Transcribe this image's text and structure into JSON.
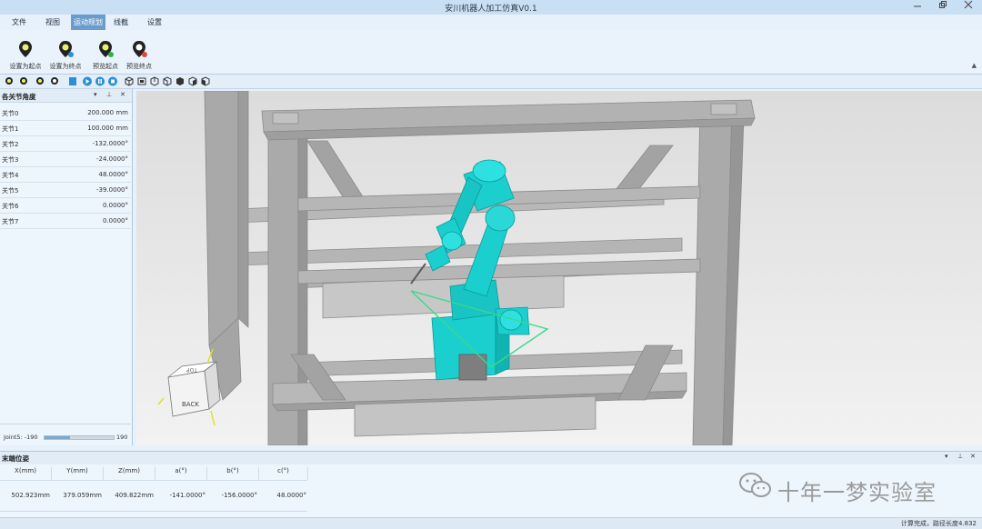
{
  "window": {
    "title": "安川机器人加工仿真V0.1"
  },
  "tabs": [
    {
      "label": "文件"
    },
    {
      "label": "视图"
    },
    {
      "label": "运动规划"
    },
    {
      "label": "线截"
    },
    {
      "label": "设置"
    }
  ],
  "ribbon": {
    "buttons": [
      {
        "label": "设置为起点",
        "icon": "set-start-point-icon"
      },
      {
        "label": "设置为终点",
        "icon": "set-end-point-icon"
      },
      {
        "label": "预览起点",
        "icon": "preview-start-icon"
      },
      {
        "label": "预览终点",
        "icon": "preview-end-icon"
      }
    ]
  },
  "left_panel": {
    "title": "各关节角度",
    "joints": [
      {
        "name": "关节0",
        "value": "200.000 mm"
      },
      {
        "name": "关节1",
        "value": "100.000 mm"
      },
      {
        "name": "关节2",
        "value": "-132.0000°"
      },
      {
        "name": "关节3",
        "value": "-24.0000°"
      },
      {
        "name": "关节4",
        "value": "48.0000°"
      },
      {
        "name": "关节5",
        "value": "-39.0000°"
      },
      {
        "name": "关节6",
        "value": "0.0000°"
      },
      {
        "name": "关节7",
        "value": "0.0000°"
      }
    ],
    "slider": {
      "label": "Joint5: -190",
      "max": "190",
      "level": 0.37
    }
  },
  "bottom_panel": {
    "title": "末端位姿",
    "headers": [
      "X(mm)",
      "Y(mm)",
      "Z(mm)",
      "a(°)",
      "b(°)",
      "c(°)"
    ],
    "values": [
      "502.923mm",
      "379.059mm",
      "409.822mm",
      "-141.0000°",
      "-156.0000°",
      "48.0000°"
    ]
  },
  "viewcube": {
    "back": "BACK",
    "top": "TOP"
  },
  "status": "计算完成，路径长度4.832",
  "watermark": "十年一梦实验室",
  "colors": {
    "robot": "#1ccfcf",
    "frame": "#a9a9a9",
    "accent": "#6c9ccc",
    "path": "#39d98a"
  }
}
